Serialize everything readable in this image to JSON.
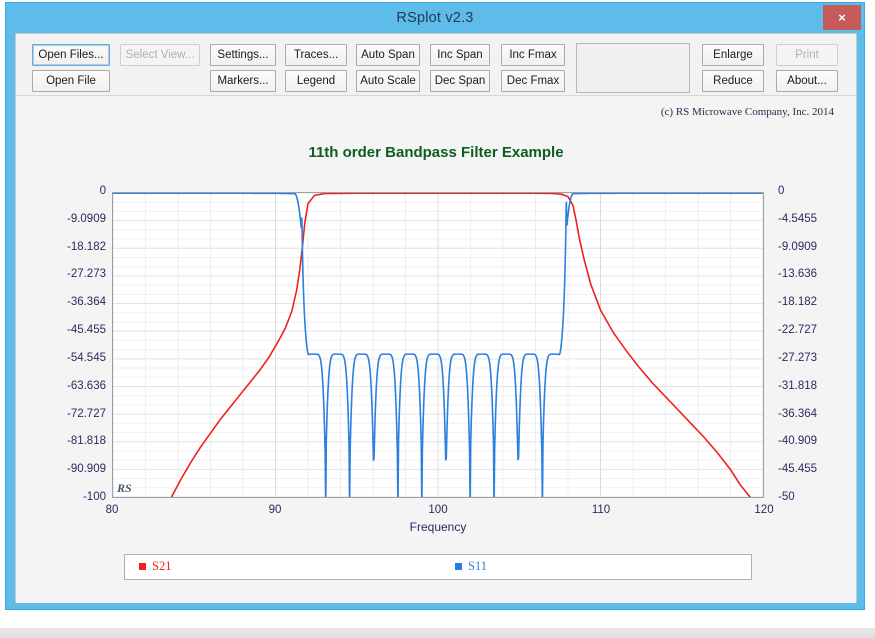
{
  "window": {
    "title": "RSplot v2.3",
    "close_label": "×",
    "title_bar_color": "#5ebcea",
    "close_button_color": "#c75b5b"
  },
  "toolbar": {
    "row1": [
      {
        "label": "Open Files...",
        "state": "focused"
      },
      {
        "label": "Select View...",
        "state": "disabled"
      },
      {
        "label": "Settings...",
        "state": "normal"
      },
      {
        "label": "Traces...",
        "state": "normal"
      },
      {
        "label": "Auto Span",
        "state": "normal"
      },
      {
        "label": "Inc Span",
        "state": "normal"
      },
      {
        "label": "Inc Fmax",
        "state": "normal"
      },
      {
        "label": "Enlarge",
        "state": "normal"
      },
      {
        "label": "Print",
        "state": "disabled"
      }
    ],
    "row2": [
      {
        "label": "Open File",
        "state": "normal"
      },
      {
        "label": "Markers...",
        "state": "normal"
      },
      {
        "label": "Legend",
        "state": "normal"
      },
      {
        "label": "Auto Scale",
        "state": "normal"
      },
      {
        "label": "Dec Span",
        "state": "normal"
      },
      {
        "label": "Dec Fmax",
        "state": "normal"
      },
      {
        "label": "Reduce",
        "state": "normal"
      },
      {
        "label": "About...",
        "state": "normal"
      }
    ]
  },
  "plot": {
    "copyright": "(c) RS Microwave Company, Inc. 2014",
    "watermark": "RS"
  },
  "chart_data": {
    "type": "line",
    "title": "11th order Bandpass Filter Example",
    "title_color": "#0d5d1f",
    "xlabel": "Frequency",
    "ylabel": "",
    "xlim": [
      80,
      120
    ],
    "xticks": [
      80,
      90,
      100,
      110,
      120
    ],
    "xticklabels": [
      "80",
      "90",
      "100",
      "110",
      "120"
    ],
    "y_left": {
      "lim": [
        -100,
        0
      ],
      "ticks": [
        0,
        -9.0909,
        -18.182,
        -27.273,
        -36.364,
        -45.455,
        -54.545,
        -63.636,
        -72.727,
        -81.818,
        -90.909,
        -100
      ],
      "ticklabels": [
        "0",
        "-9.0909",
        "-18.182",
        "-27.273",
        "-36.364",
        "-45.455",
        "-54.545",
        "-63.636",
        "-72.727",
        "-81.818",
        "-90.909",
        "-100"
      ]
    },
    "y_right": {
      "lim": [
        -50,
        0
      ],
      "ticks": [
        0,
        -4.5455,
        -9.0909,
        -13.636,
        -18.182,
        -22.727,
        -27.273,
        -31.818,
        -36.364,
        -40.909,
        -45.455,
        -50
      ],
      "ticklabels": [
        "0",
        "-4.5455",
        "-9.0909",
        "-13.636",
        "-18.182",
        "-22.727",
        "-27.273",
        "-31.818",
        "-36.364",
        "-40.909",
        "-45.455",
        "-50"
      ]
    },
    "grid": true,
    "legend_position": "bottom",
    "series": [
      {
        "name": "S21",
        "color": "#f02020",
        "axis": "left",
        "x": [
          80,
          81,
          82,
          83,
          83.6,
          84.2,
          84.8,
          85.4,
          86,
          86.6,
          87.2,
          87.8,
          88.4,
          89,
          89.6,
          90.2,
          90.6,
          91,
          91.3,
          91.5,
          91.65,
          91.8,
          92,
          92.4,
          93,
          95,
          98,
          101,
          104,
          106,
          107,
          107.6,
          108,
          108.3,
          108.5,
          108.7,
          109,
          109.4,
          110,
          110.8,
          111.6,
          112.4,
          113.2,
          114,
          114.8,
          115.6,
          116.4,
          117.2,
          118,
          118.6,
          119.2,
          120
        ],
        "y": [
          -132,
          -125,
          -118,
          -110,
          -100,
          -94,
          -88.5,
          -83.5,
          -79,
          -74.5,
          -70.5,
          -66.5,
          -62.5,
          -58.5,
          -54,
          -48.5,
          -44.5,
          -39,
          -32,
          -25,
          -18,
          -10,
          -3.5,
          -0.8,
          -0.2,
          -0.05,
          -0.05,
          -0.05,
          -0.05,
          -0.08,
          -0.15,
          -0.4,
          -1.2,
          -4,
          -9,
          -15,
          -22,
          -30,
          -38.5,
          -46,
          -52,
          -57.5,
          -62.5,
          -67,
          -71.5,
          -76,
          -80.5,
          -85.5,
          -91,
          -96,
          -100,
          -112
        ]
      },
      {
        "name": "S11",
        "color": "#2a7fe0",
        "axis": "right",
        "note": "Return loss: near 0 dB outside passband, equiripple with 11 lobes inside passband ~91.6 to 107.9 MHz",
        "passband": [
          91.6,
          107.9
        ],
        "ripple_peak_db": -26.5,
        "ripple_null_db": -46,
        "deep_null_db": -50,
        "ripple_peak_count": 11
      }
    ]
  },
  "legend": {
    "entries": [
      {
        "label": "S21",
        "color": "#f02020"
      },
      {
        "label": "S11",
        "color": "#2a7fe0"
      }
    ]
  }
}
